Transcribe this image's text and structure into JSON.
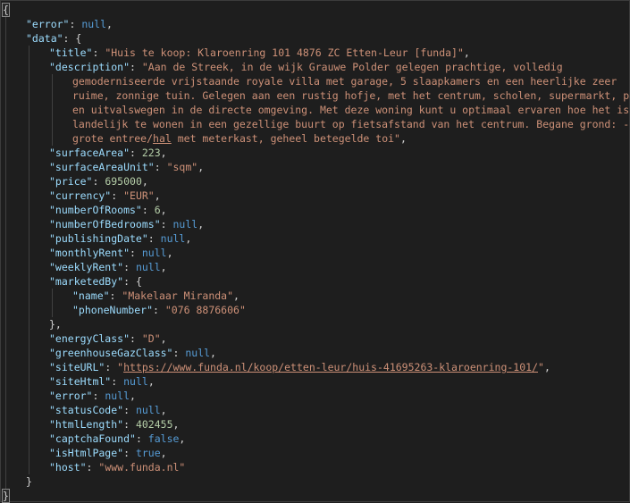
{
  "lines": [
    {
      "i": 0,
      "parts": [
        [
          "p",
          "{"
        ]
      ]
    },
    {
      "i": 1,
      "parts": [
        [
          "k",
          "\"error\""
        ],
        [
          "p",
          ": "
        ],
        [
          "kw",
          "null"
        ],
        [
          "p",
          ","
        ]
      ]
    },
    {
      "i": 1,
      "parts": [
        [
          "k",
          "\"data\""
        ],
        [
          "p",
          ": {"
        ]
      ]
    },
    {
      "i": 2,
      "parts": [
        [
          "k",
          "\"title\""
        ],
        [
          "p",
          ": "
        ],
        [
          "s",
          "\"Huis te koop: Klaroenring 101 4876 ZC Etten-Leur [funda]\""
        ],
        [
          "p",
          ","
        ]
      ]
    },
    {
      "i": 2,
      "parts": [
        [
          "k",
          "\"description\""
        ],
        [
          "p",
          ": "
        ],
        [
          "s",
          "\"Aan de Streek, in de wijk Grauwe Polder gelegen prachtige, volledig"
        ]
      ]
    },
    {
      "i": 3,
      "parts": [
        [
          "s",
          "gemoderniseerde vrijstaande royale villa met garage, 5 slaapkamers en een heerlijke zeer"
        ]
      ]
    },
    {
      "i": 3,
      "parts": [
        [
          "s",
          "ruime, zonnige tuin. Gelegen aan een rustig hofje, met het centrum, scholen, supermarkt, park"
        ]
      ]
    },
    {
      "i": 3,
      "parts": [
        [
          "s",
          "en uitvalswegen in de directe omgeving. Met deze woning kunt u optimaal ervaren hoe het is om"
        ]
      ]
    },
    {
      "i": 3,
      "parts": [
        [
          "s",
          "landelijk te wonen in een gezellige buurt op fietsafstand van het centrum. Begane grond: -"
        ]
      ]
    },
    {
      "i": 3,
      "parts": [
        [
          "s",
          "grote entree/"
        ],
        [
          "su",
          "hal"
        ],
        [
          "s",
          " met meterkast, geheel betegelde toi\""
        ],
        [
          "p",
          ","
        ]
      ]
    },
    {
      "i": 2,
      "parts": [
        [
          "k",
          "\"surfaceArea\""
        ],
        [
          "p",
          ": "
        ],
        [
          "n",
          "223"
        ],
        [
          "p",
          ","
        ]
      ]
    },
    {
      "i": 2,
      "parts": [
        [
          "k",
          "\"surfaceAreaUnit\""
        ],
        [
          "p",
          ": "
        ],
        [
          "s",
          "\"sqm\""
        ],
        [
          "p",
          ","
        ]
      ]
    },
    {
      "i": 2,
      "parts": [
        [
          "k",
          "\"price\""
        ],
        [
          "p",
          ": "
        ],
        [
          "n",
          "695000"
        ],
        [
          "p",
          ","
        ]
      ]
    },
    {
      "i": 2,
      "parts": [
        [
          "k",
          "\"currency\""
        ],
        [
          "p",
          ": "
        ],
        [
          "s",
          "\"EUR\""
        ],
        [
          "p",
          ","
        ]
      ]
    },
    {
      "i": 2,
      "parts": [
        [
          "k",
          "\"numberOfRooms\""
        ],
        [
          "p",
          ": "
        ],
        [
          "n",
          "6"
        ],
        [
          "p",
          ","
        ]
      ]
    },
    {
      "i": 2,
      "parts": [
        [
          "k",
          "\"numberOfBedrooms\""
        ],
        [
          "p",
          ": "
        ],
        [
          "kw",
          "null"
        ],
        [
          "p",
          ","
        ]
      ]
    },
    {
      "i": 2,
      "parts": [
        [
          "k",
          "\"publishingDate\""
        ],
        [
          "p",
          ": "
        ],
        [
          "kw",
          "null"
        ],
        [
          "p",
          ","
        ]
      ]
    },
    {
      "i": 2,
      "parts": [
        [
          "k",
          "\"monthlyRent\""
        ],
        [
          "p",
          ": "
        ],
        [
          "kw",
          "null"
        ],
        [
          "p",
          ","
        ]
      ]
    },
    {
      "i": 2,
      "parts": [
        [
          "k",
          "\"weeklyRent\""
        ],
        [
          "p",
          ": "
        ],
        [
          "kw",
          "null"
        ],
        [
          "p",
          ","
        ]
      ]
    },
    {
      "i": 2,
      "parts": [
        [
          "k",
          "\"marketedBy\""
        ],
        [
          "p",
          ": {"
        ]
      ]
    },
    {
      "i": 3,
      "parts": [
        [
          "k",
          "\"name\""
        ],
        [
          "p",
          ": "
        ],
        [
          "s",
          "\"Makelaar Miranda\""
        ],
        [
          "p",
          ","
        ]
      ]
    },
    {
      "i": 3,
      "parts": [
        [
          "k",
          "\"phoneNumber\""
        ],
        [
          "p",
          ": "
        ],
        [
          "s",
          "\"076 8876606\""
        ]
      ]
    },
    {
      "i": 2,
      "parts": [
        [
          "p",
          "},"
        ]
      ]
    },
    {
      "i": 2,
      "parts": [
        [
          "k",
          "\"energyClass\""
        ],
        [
          "p",
          ": "
        ],
        [
          "s",
          "\"D\""
        ],
        [
          "p",
          ","
        ]
      ]
    },
    {
      "i": 2,
      "parts": [
        [
          "k",
          "\"greenhouseGazClass\""
        ],
        [
          "p",
          ": "
        ],
        [
          "kw",
          "null"
        ],
        [
          "p",
          ","
        ]
      ]
    },
    {
      "i": 2,
      "parts": [
        [
          "k",
          "\"siteURL\""
        ],
        [
          "p",
          ": "
        ],
        [
          "s",
          "\""
        ],
        [
          "su",
          "https://www.funda.nl/koop/etten-leur/huis-41695263-klaroenring-101/"
        ],
        [
          "s",
          "\""
        ],
        [
          "p",
          ","
        ]
      ]
    },
    {
      "i": 2,
      "parts": [
        [
          "k",
          "\"siteHtml\""
        ],
        [
          "p",
          ": "
        ],
        [
          "kw",
          "null"
        ],
        [
          "p",
          ","
        ]
      ]
    },
    {
      "i": 2,
      "parts": [
        [
          "k",
          "\"error\""
        ],
        [
          "p",
          ": "
        ],
        [
          "kw",
          "null"
        ],
        [
          "p",
          ","
        ]
      ]
    },
    {
      "i": 2,
      "parts": [
        [
          "k",
          "\"statusCode\""
        ],
        [
          "p",
          ": "
        ],
        [
          "kw",
          "null"
        ],
        [
          "p",
          ","
        ]
      ]
    },
    {
      "i": 2,
      "parts": [
        [
          "k",
          "\"htmlLength\""
        ],
        [
          "p",
          ": "
        ],
        [
          "n",
          "402455"
        ],
        [
          "p",
          ","
        ]
      ]
    },
    {
      "i": 2,
      "parts": [
        [
          "k",
          "\"captchaFound\""
        ],
        [
          "p",
          ": "
        ],
        [
          "kw",
          "false"
        ],
        [
          "p",
          ","
        ]
      ]
    },
    {
      "i": 2,
      "parts": [
        [
          "k",
          "\"isHtmlPage\""
        ],
        [
          "p",
          ": "
        ],
        [
          "kw",
          "true"
        ],
        [
          "p",
          ","
        ]
      ]
    },
    {
      "i": 2,
      "parts": [
        [
          "k",
          "\"host\""
        ],
        [
          "p",
          ": "
        ],
        [
          "s",
          "\"www.funda.nl\""
        ]
      ]
    },
    {
      "i": 1,
      "parts": [
        [
          "p",
          "}"
        ]
      ]
    },
    {
      "i": 0,
      "parts": [
        [
          "p",
          "}"
        ]
      ]
    }
  ]
}
